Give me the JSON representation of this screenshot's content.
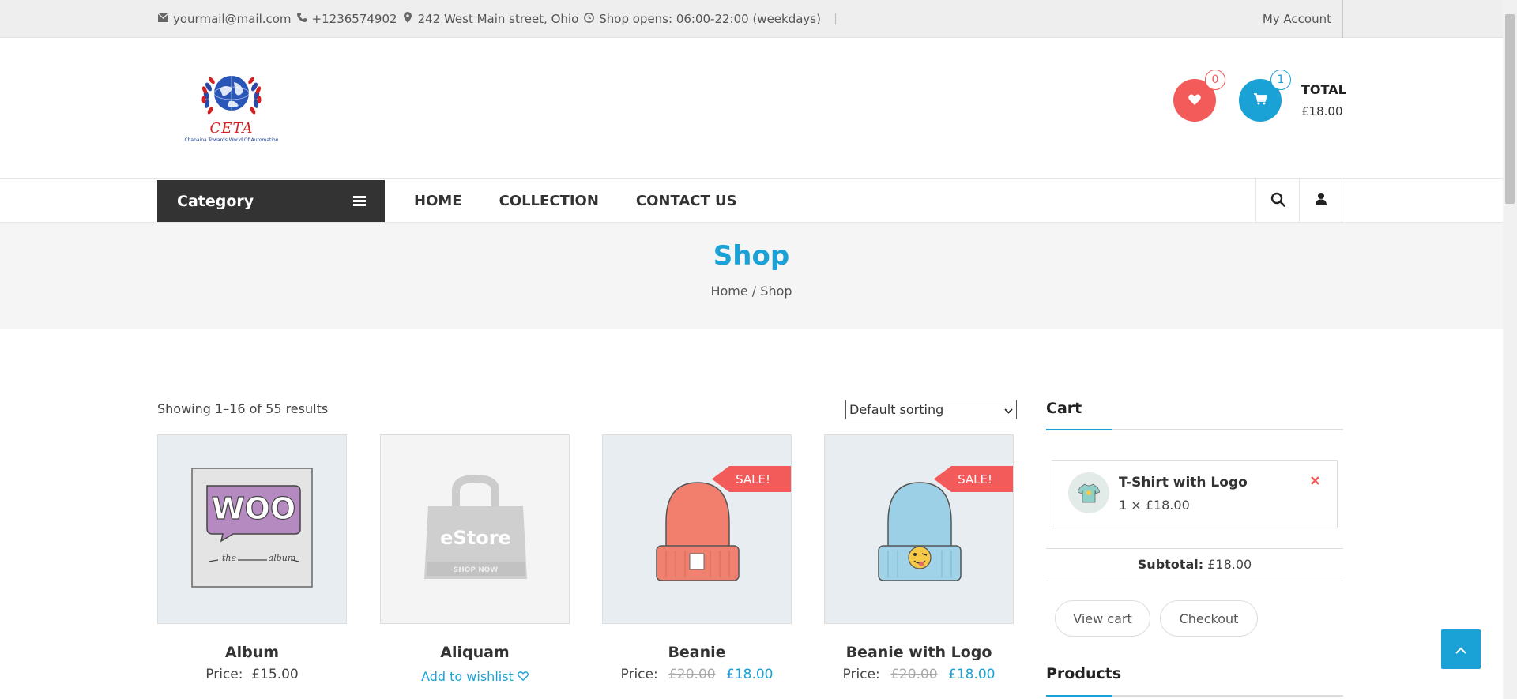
{
  "topbar": {
    "email": "yourmail@mail.com",
    "phone": "+1236574902",
    "address": "242 West Main street, Ohio",
    "hours": "Shop opens: 06:00-22:00 (weekdays)",
    "account": "My Account",
    "icons": [
      "envelope-icon",
      "phone-icon",
      "map-marker-icon",
      "clock-icon"
    ]
  },
  "logo": {
    "title": "CETA",
    "subtitle": "Chanaina Towards World Of Automation"
  },
  "header": {
    "wishlist_count": "0",
    "cart_count": "1",
    "total_label": "TOTAL",
    "total_value": "£18.00"
  },
  "nav": {
    "category": "Category",
    "menu": [
      "HOME",
      "COLLECTION",
      "CONTACT US"
    ]
  },
  "banner": {
    "title": "Shop",
    "breadcrumb": "Home / Shop"
  },
  "shop": {
    "results": "Showing 1–16 of 55 results",
    "sorting": "Default sorting"
  },
  "products": [
    {
      "name": "Album",
      "price_label": "Price:",
      "price": "£15.00",
      "sale": false
    },
    {
      "name": "Aliquam",
      "wishlist": "Add to wishlist",
      "sale": false
    },
    {
      "name": "Beanie",
      "price_label": "Price:",
      "old_price": "£20.00",
      "price": "£18.00",
      "sale": true,
      "badge": "SALE!"
    },
    {
      "name": "Beanie with Logo",
      "price_label": "Price:",
      "old_price": "£20.00",
      "price": "£18.00",
      "sale": true,
      "badge": "SALE!"
    }
  ],
  "placeholder_image": {
    "brand": "eStore",
    "cta": "SHOP NOW"
  },
  "album_art": {
    "logo": "WOO",
    "caption_left": "the",
    "caption_right": "album"
  },
  "sidebar": {
    "cart_title": "Cart",
    "cart_item": {
      "name": "T-Shirt with Logo",
      "qty": "1 × £18.00"
    },
    "subtotal_label": "Subtotal:",
    "subtotal_value": "£18.00",
    "view_cart": "View cart",
    "checkout": "Checkout",
    "products_title": "Products"
  },
  "colors": {
    "accent": "#1aa1d6",
    "sale": "#f35a5a",
    "dark": "#333333"
  }
}
